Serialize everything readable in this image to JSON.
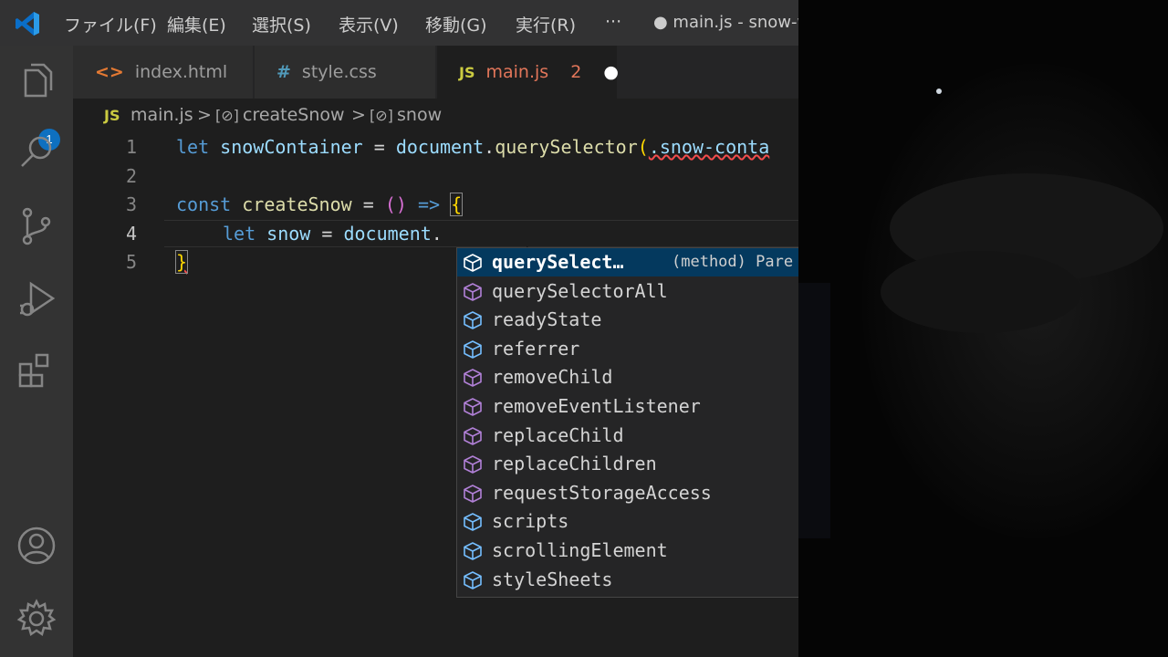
{
  "titlebar": {
    "menu": [
      "ファイル(F)",
      "編集(E)",
      "選択(S)",
      "表示(V)",
      "移動(G)",
      "実行(R)",
      "···"
    ],
    "doc_title": "● main.js - snow-w"
  },
  "activitybar": {
    "explorer_badge": "1",
    "icons": [
      "files-icon",
      "search-icon",
      "source-control-icon",
      "run-debug-icon",
      "extensions-icon",
      "account-icon",
      "settings-gear-icon"
    ]
  },
  "tabs": [
    {
      "icon": "<>",
      "label": "index.html",
      "icon_color": "#e37933"
    },
    {
      "icon": "#",
      "label": "style.css",
      "icon_color": "#519aba"
    },
    {
      "icon": "JS",
      "label": "main.js",
      "icon_color": "#cbcb41",
      "problems": "2",
      "dirty": "●"
    }
  ],
  "breadcrumb": {
    "file_icon": "JS",
    "file": "main.js",
    "sep": ">",
    "symbol1_icon": "[⊘]",
    "symbol1": "createSnow",
    "symbol2_icon": "[⊘]",
    "symbol2": "snow"
  },
  "editor": {
    "line_numbers": [
      "1",
      "2",
      "3",
      "4",
      "5"
    ],
    "current_line": "4",
    "line1": {
      "kw": "let",
      "var": "snowContainer",
      "eq": " = ",
      "obj": "document",
      "dot": ".",
      "fn": "querySelector",
      "open": "(",
      "str": ".snow-conta"
    },
    "line3": {
      "kw": "const",
      "fn": "createSnow",
      "eq": " = ",
      "parens": "()",
      "arrow": " => ",
      "brace": "{"
    },
    "line4": {
      "kw": "let",
      "var": "snow",
      "eq": " = ",
      "obj": "document",
      "dot": "."
    },
    "line5": {
      "brace": "}"
    }
  },
  "suggest": {
    "items": [
      {
        "label": "querySelect…",
        "kind": "method",
        "detail": "(method) Pare"
      },
      {
        "label": "querySelectorAll",
        "kind": "method"
      },
      {
        "label": "readyState",
        "kind": "property"
      },
      {
        "label": "referrer",
        "kind": "property"
      },
      {
        "label": "removeChild",
        "kind": "method"
      },
      {
        "label": "removeEventListener",
        "kind": "method"
      },
      {
        "label": "replaceChild",
        "kind": "method"
      },
      {
        "label": "replaceChildren",
        "kind": "method"
      },
      {
        "label": "requestStorageAccess",
        "kind": "method"
      },
      {
        "label": "scripts",
        "kind": "property"
      },
      {
        "label": "scrollingElement",
        "kind": "property"
      },
      {
        "label": "styleSheets",
        "kind": "property"
      }
    ],
    "colors": {
      "method": "#b180d7",
      "property": "#75beff"
    }
  },
  "colors": {
    "editor_bg": "#1e1e1e",
    "activitybar_bg": "#333333",
    "titlebar_bg": "#323233",
    "badge": "#0e70c0",
    "selection": "#04395e"
  }
}
